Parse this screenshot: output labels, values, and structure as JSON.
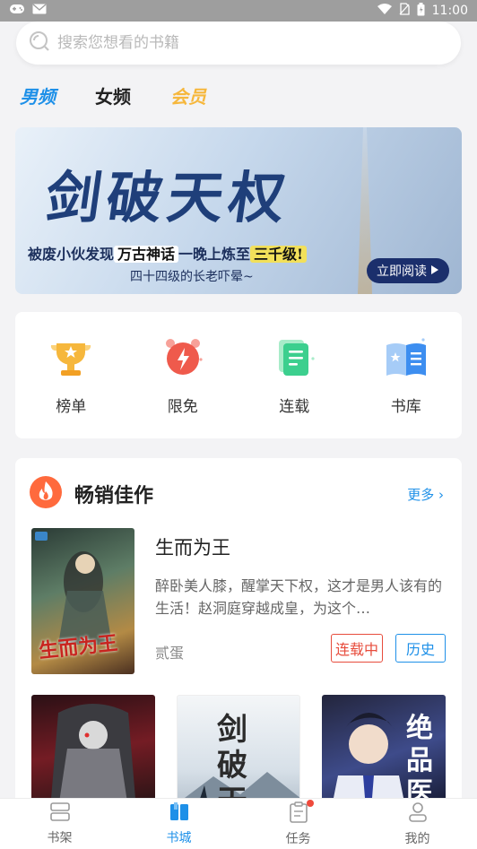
{
  "status_bar": {
    "time": "11:00"
  },
  "search": {
    "placeholder": "搜索您想看的书籍"
  },
  "tabs": [
    {
      "label": "男频",
      "active": true
    },
    {
      "label": "女频",
      "active": false
    },
    {
      "label": "会员",
      "active": false
    }
  ],
  "banner": {
    "title": "剑破天权",
    "line1_pre": "被废小伙发现",
    "line1_hl": "万古神话",
    "line1_mid": "一晚上炼至",
    "line1_hl2": "三千级!",
    "line2": "四十四级的长老吓晕~",
    "cta": "立即阅读"
  },
  "quick_links": [
    {
      "label": "榜单",
      "icon": "trophy-icon",
      "color": "#f6b73c"
    },
    {
      "label": "限免",
      "icon": "alarm-clock-icon",
      "color": "#ef5a4c"
    },
    {
      "label": "连载",
      "icon": "document-icon",
      "color": "#3ccf8e"
    },
    {
      "label": "书库",
      "icon": "open-book-icon",
      "color": "#3d8ef0"
    }
  ],
  "bestsellers": {
    "title": "畅销佳作",
    "more": "更多",
    "featured": {
      "name": "生而为王",
      "description": "醉卧美人膝，醒掌天下权，这才是男人该有的生活！赵洞庭穿越成皇，为这个…",
      "author": "贰蛋",
      "status": "连载中",
      "category": "历史",
      "cover_text": "生而为王"
    },
    "covers": [
      {
        "text": ""
      },
      {
        "text": "剑破天"
      },
      {
        "text": "绝品医"
      }
    ]
  },
  "tabbar": [
    {
      "label": "书架",
      "icon": "bookshelf-icon",
      "active": false
    },
    {
      "label": "书城",
      "icon": "bookstore-icon",
      "active": true
    },
    {
      "label": "任务",
      "icon": "clipboard-icon",
      "active": false,
      "badge": true
    },
    {
      "label": "我的",
      "icon": "user-icon",
      "active": false
    }
  ],
  "colors": {
    "accent": "#1e90e8",
    "vip": "#f6b73c",
    "serial": "#e74c3c"
  }
}
